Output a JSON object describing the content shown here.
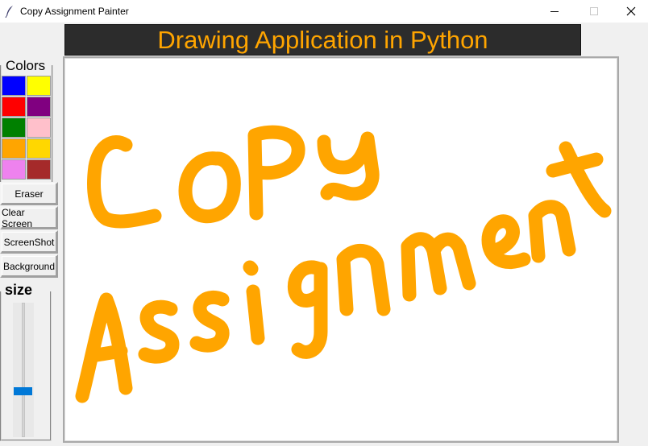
{
  "window": {
    "title": "Copy Assignment Painter"
  },
  "header": {
    "title": "Drawing Application in Python"
  },
  "colors": {
    "label": "Colors",
    "swatches": [
      {
        "name": "blue",
        "color": "#0000ff"
      },
      {
        "name": "yellow",
        "color": "#ffff00"
      },
      {
        "name": "red",
        "color": "#ff0000"
      },
      {
        "name": "purple",
        "color": "#800080"
      },
      {
        "name": "green",
        "color": "#008000"
      },
      {
        "name": "pink",
        "color": "#ffc0cb"
      },
      {
        "name": "orange",
        "color": "#ffa500"
      },
      {
        "name": "gold",
        "color": "#ffd700"
      },
      {
        "name": "violet",
        "color": "#ee82ee"
      },
      {
        "name": "brown",
        "color": "#a52a2a"
      }
    ]
  },
  "tools": {
    "eraser": "Eraser",
    "clear": "Clear Screen",
    "screenshot": "ScreenShot",
    "background": "Background"
  },
  "size": {
    "label": "size",
    "level": 0.67
  },
  "canvas": {
    "background": "#ffffff",
    "stroke_color": "#ffa500",
    "drawn_text_line1": "COPY",
    "drawn_text_line2": "Assignment"
  }
}
